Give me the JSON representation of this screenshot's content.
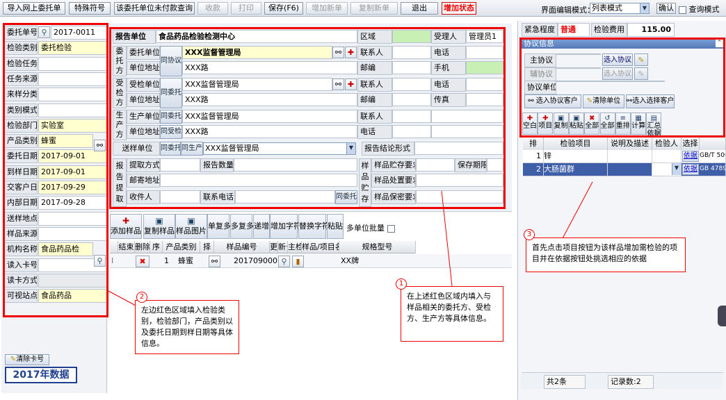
{
  "toolbar": {
    "import": "导入网上委托单",
    "special": "特殊符号",
    "query": "该委托单位未付款查询",
    "collect": "收款",
    "print": "打印",
    "save": "保存(F6)",
    "add_new": "增加新单",
    "copy_new": "复制新单",
    "exit": "退出",
    "state": "增加状态",
    "mode_label": "界面编辑模式：",
    "mode_value": "列表模式",
    "confirm": "确认",
    "query_mode": "查询模式"
  },
  "left": {
    "labels": [
      "委托单号",
      "检验类别",
      "检验任务",
      "任务来源",
      "来样分类",
      "类别模式",
      "检验部门",
      "产品类别",
      "委托日期",
      "到样日期",
      "交客户日",
      "内部日期",
      "送样地点",
      "样品来源",
      "机构名称",
      "读入卡号",
      "读卡方式",
      "可视站点"
    ],
    "values": {
      "order_no": "2017-0011",
      "category": "委托检验",
      "dept": "实验室",
      "product": "蜂蜜",
      "d1": "2017-09-01",
      "d2": "2017-09-01",
      "d3": "2017-09-29",
      "d4": "2017-09-28",
      "org": "食品药品检",
      "site": "食品药品"
    },
    "clear_card": "清除卡号",
    "banner": "2017年数据"
  },
  "center": {
    "report_unit_label": "报告单位",
    "report_unit_value": "食品药品检验检测中心",
    "region": "区域",
    "receiver": "受理人",
    "receiver_value": "管理员1",
    "client_side": "委托方",
    "client_unit": "委托单位",
    "client_unit_value": "XXX监督管理局",
    "address": "单位地址",
    "address_value": "XXX路",
    "same_protocol": "同协议",
    "contact": "联系人",
    "phone": "电话",
    "postcode": "邮编",
    "mobile": "手机",
    "fax": "传真",
    "inspected_side": "受检方",
    "inspected_unit": "受检单位",
    "inspected_unit_value": "XXX监督管理局",
    "same_client": "同委托",
    "producer_side": "生产方",
    "producer_unit": "生产单位",
    "producer_unit_value": "XXX监督管理局",
    "same_inspected": "同受检",
    "delivery_unit": "送样单位",
    "same_producer": "同生产",
    "delivery_value": "XXX监督管理局",
    "conclusion": "报告结论形式",
    "report_pick": "报告提取",
    "pick_method": "提取方式",
    "report_count": "报告数量",
    "mail_address": "邮寄地址",
    "recipient": "收件人",
    "contact_phone": "联系电话",
    "storage": "样品贮存",
    "store_req": "样品贮存要求",
    "keep_period": "保存期限",
    "dispose_req": "样品处置要求",
    "secret_req": "样品保密要求"
  },
  "sample_tools": [
    "添加样品",
    "复制样品",
    "样品图片",
    "单复多",
    "多复多",
    "递增",
    "增加字符",
    "替换字符",
    "粘贴"
  ],
  "multi_batch": "多单位批量",
  "sample_cols": [
    "结束",
    "删除",
    "序",
    "产品类别",
    "择",
    "样品编号",
    "更",
    "新号",
    "主检人",
    "样品/项目名称",
    "规格型号"
  ],
  "sample_row": {
    "seq": "1",
    "product": "蜂蜜",
    "sample_no": "2017090001",
    "name": "XX牌"
  },
  "right": {
    "urgency_label": "紧急程度",
    "urgency_value": "普通",
    "fee_label": "检验费用",
    "fee_value": "115.00",
    "protocol_title": "协议信息",
    "main_protocol": "主协议",
    "aux_protocol": "辅协议",
    "protocol_unit": "协议单位",
    "pick_protocol": "选入协议",
    "pick_client": "选入协议客户",
    "clear_unit": "清除单位",
    "pick_customer": "选入选择客户",
    "item_tools": [
      "空白",
      "项目",
      "复制",
      "粘贴",
      "全部",
      "全部",
      "重排",
      "计算",
      "汇总"
    ],
    "item_tools2": [
      "",
      "",
      "",
      "",
      "",
      "",
      "",
      "",
      "依据"
    ],
    "item_cols": [
      "排",
      "检验项目",
      "说明及描述",
      "检验人",
      "选择"
    ],
    "items": [
      {
        "no": "1",
        "name": "锌",
        "basis": "依据",
        "std": "GB/T 500"
      },
      {
        "no": "2",
        "name": "大肠菌群",
        "basis": "依据",
        "std": "GB 4789"
      }
    ],
    "total": "共2条",
    "records": "记录数:2"
  },
  "callouts": {
    "c1": "在上述红色区域内填入与样品相关的委托方、受检方、生产方等具体信息。",
    "c2": "左边红色区域填入检验类别，检验部门，产品类别以及委托日期到样日期等具体信息。",
    "c3": "首先点击项目按钮为该样品增加需检验的项目并在依据按钮处挑选相应的依据"
  }
}
